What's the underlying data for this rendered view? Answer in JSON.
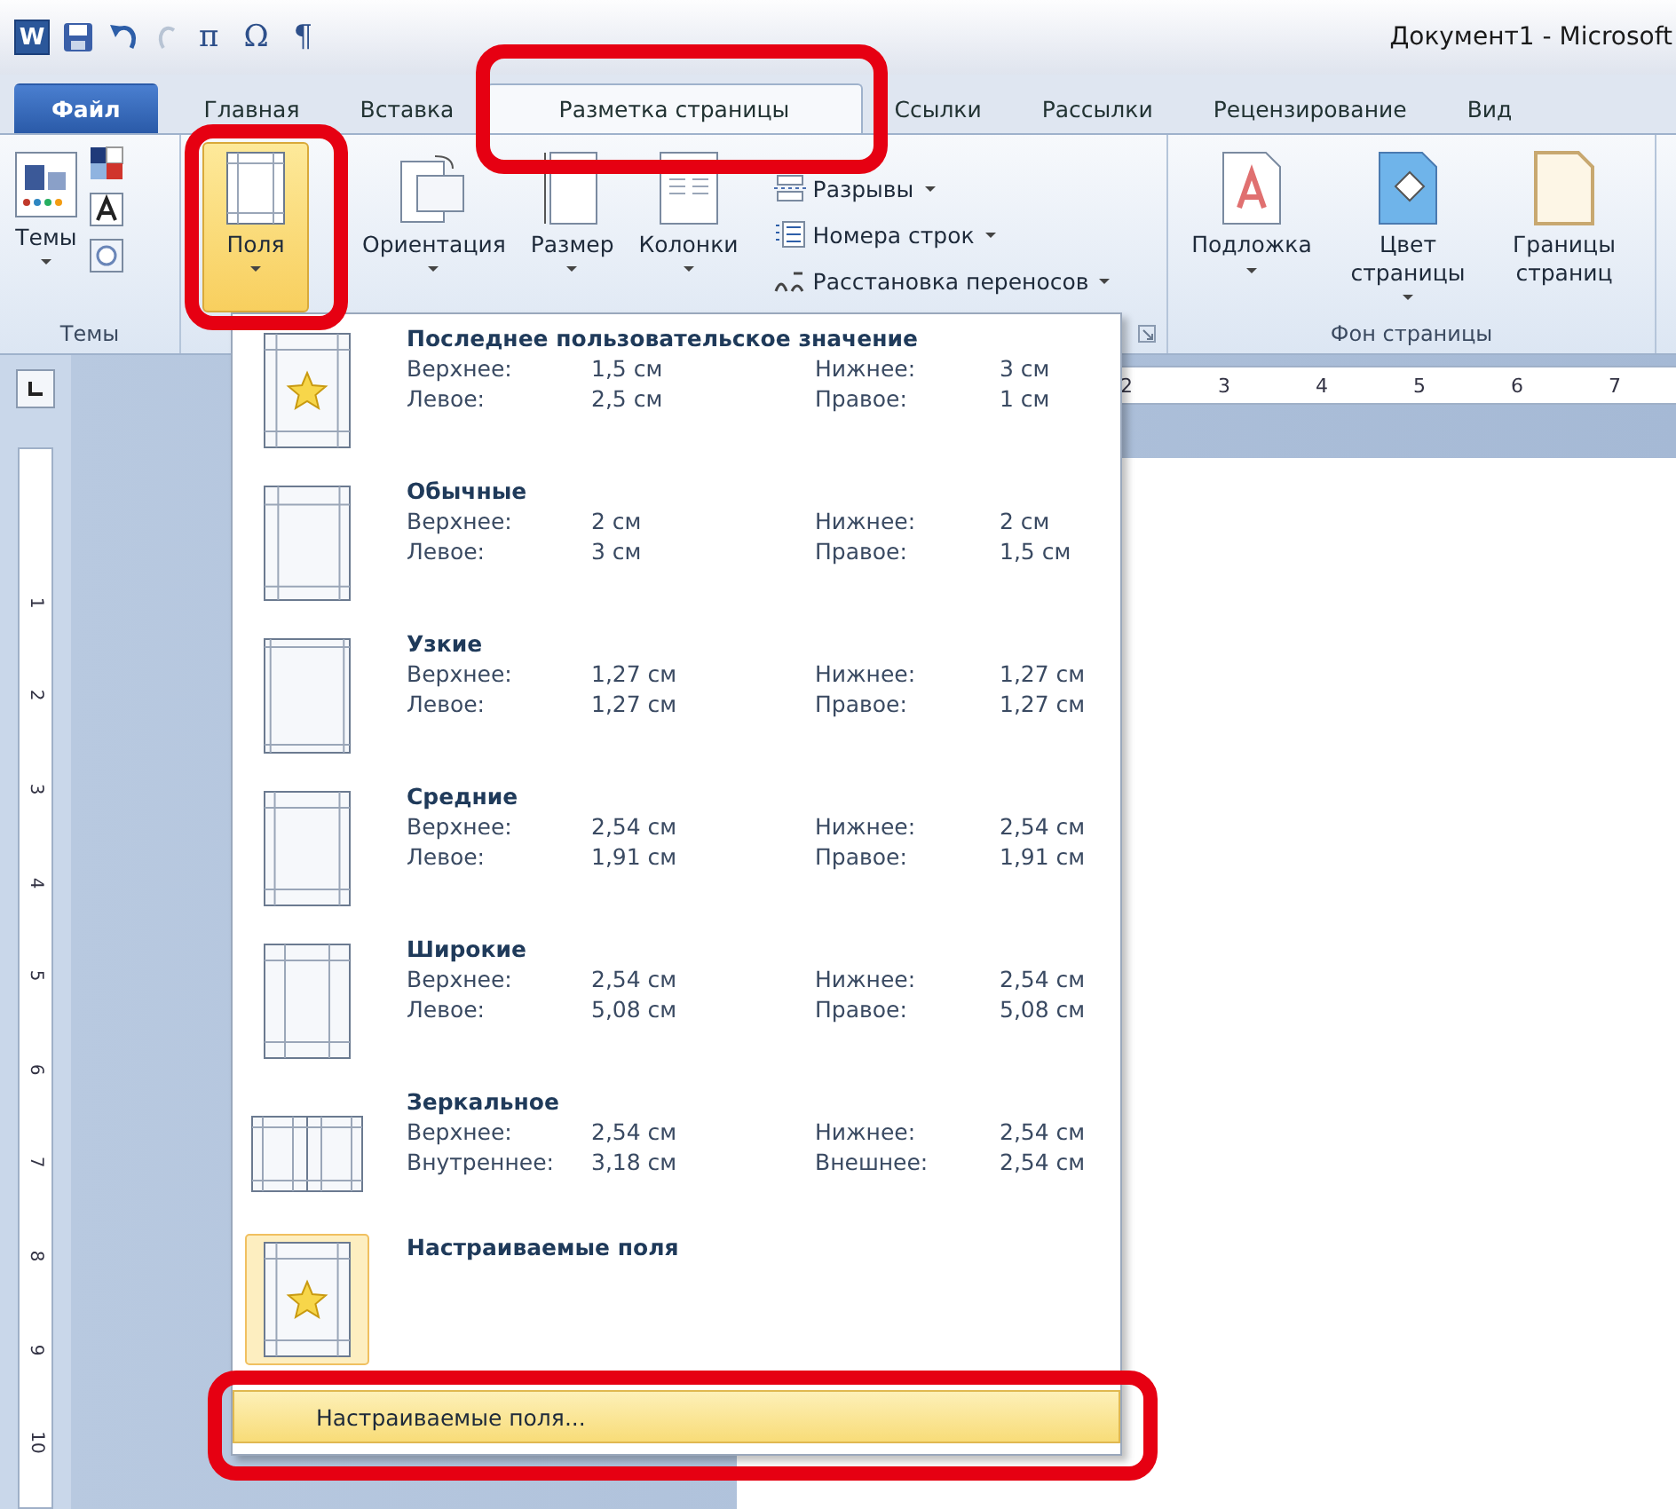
{
  "title_bar": {
    "app_icon": "W",
    "quick_access": [
      "π",
      "Ω",
      "¶"
    ],
    "title": "Документ1 - Microsoft"
  },
  "tabs": [
    {
      "label": "Файл",
      "kind": "file",
      "selected": false
    },
    {
      "label": "Главная",
      "kind": "tab",
      "selected": false
    },
    {
      "label": "Вставка",
      "kind": "tab",
      "selected": false
    },
    {
      "label": "Разметка страницы",
      "kind": "tab",
      "selected": true
    },
    {
      "label": "Ссылки",
      "kind": "tab",
      "selected": false
    },
    {
      "label": "Рассылки",
      "kind": "tab",
      "selected": false
    },
    {
      "label": "Рецензирование",
      "kind": "tab",
      "selected": false
    },
    {
      "label": "Вид",
      "kind": "tab",
      "selected": false
    }
  ],
  "ribbon": {
    "themes_group": {
      "button": "Темы",
      "label": "Темы"
    },
    "page_setup_group": {
      "large_buttons": [
        {
          "label": "Поля",
          "kind": "margins",
          "selected": true
        },
        {
          "label": "Ориентация",
          "kind": "orientation",
          "selected": false
        },
        {
          "label": "Размер",
          "kind": "size",
          "selected": false
        },
        {
          "label": "Колонки",
          "kind": "columns",
          "selected": false
        }
      ],
      "small_buttons": [
        {
          "label": "Разрывы",
          "kind": "breaks"
        },
        {
          "label": "Номера строк",
          "kind": "line_numbers"
        },
        {
          "label": "Расстановка переносов",
          "kind": "hyphenation"
        }
      ]
    },
    "background_group": {
      "label": "Фон страницы",
      "buttons": [
        {
          "label": "Подложка",
          "kind": "watermark"
        },
        {
          "label": "Цвет страницы",
          "kind": "color"
        },
        {
          "label": "Границы страниц",
          "kind": "borders"
        }
      ]
    }
  },
  "horizontal_ruler": [
    "2",
    "3",
    "4",
    "5",
    "6",
    "7"
  ],
  "vertical_ruler": [
    "1",
    "2",
    "3",
    "4",
    "5",
    "6",
    "7",
    "8",
    "9",
    "10"
  ],
  "margins_menu": {
    "items": [
      {
        "title": "Последнее пользовательское значение",
        "kind": "last",
        "selected": false,
        "values": [
          {
            "label": "Верхнее:",
            "value": "1,5 см"
          },
          {
            "label": "Нижнее:",
            "value": "3 см"
          },
          {
            "label": "Левое:",
            "value": "2,5 см"
          },
          {
            "label": "Правое:",
            "value": "1 см"
          }
        ]
      },
      {
        "title": "Обычные",
        "kind": "normal",
        "selected": false,
        "values": [
          {
            "label": "Верхнее:",
            "value": "2 см"
          },
          {
            "label": "Нижнее:",
            "value": "2 см"
          },
          {
            "label": "Левое:",
            "value": "3 см"
          },
          {
            "label": "Правое:",
            "value": "1,5 см"
          }
        ]
      },
      {
        "title": "Узкие",
        "kind": "narrow",
        "selected": false,
        "values": [
          {
            "label": "Верхнее:",
            "value": "1,27 см"
          },
          {
            "label": "Нижнее:",
            "value": "1,27 см"
          },
          {
            "label": "Левое:",
            "value": "1,27 см"
          },
          {
            "label": "Правое:",
            "value": "1,27 см"
          }
        ]
      },
      {
        "title": "Средние",
        "kind": "moderate",
        "selected": false,
        "values": [
          {
            "label": "Верхнее:",
            "value": "2,54 см"
          },
          {
            "label": "Нижнее:",
            "value": "2,54 см"
          },
          {
            "label": "Левое:",
            "value": "1,91 см"
          },
          {
            "label": "Правое:",
            "value": "1,91 см"
          }
        ]
      },
      {
        "title": "Широкие",
        "kind": "wide",
        "selected": false,
        "values": [
          {
            "label": "Верхнее:",
            "value": "2,54 см"
          },
          {
            "label": "Нижнее:",
            "value": "2,54 см"
          },
          {
            "label": "Левое:",
            "value": "5,08 см"
          },
          {
            "label": "Правое:",
            "value": "5,08 см"
          }
        ]
      },
      {
        "title": "Зеркальное",
        "kind": "mirrored",
        "selected": false,
        "values": [
          {
            "label": "Верхнее:",
            "value": "2,54 см"
          },
          {
            "label": "Нижнее:",
            "value": "2,54 см"
          },
          {
            "label": "Внутреннее:",
            "value": "3,18 см"
          },
          {
            "label": "Внешнее:",
            "value": "2,54 см"
          }
        ]
      },
      {
        "title": "Настраиваемые поля",
        "kind": "custom",
        "selected": true
      }
    ],
    "command": {
      "label": "Настраиваемые поля...",
      "highlighted": true
    }
  }
}
